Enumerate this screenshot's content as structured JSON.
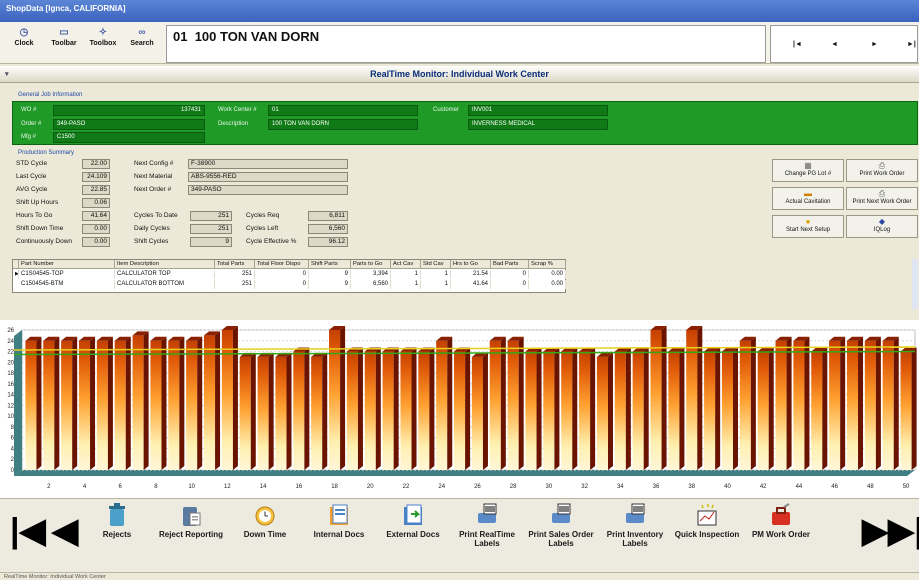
{
  "window": {
    "title": "ShopData [Ignca, CALIFORNIA]"
  },
  "toolbar": {
    "buttons": [
      {
        "label": "Clock",
        "icon": "clock-icon"
      },
      {
        "label": "Toolbar",
        "icon": "toolbar-icon"
      },
      {
        "label": "Toolbox",
        "icon": "toolbox-icon"
      },
      {
        "label": "Search",
        "icon": "binoculars-icon"
      }
    ]
  },
  "header": {
    "station": "01",
    "name": "100 TON VAN DORN"
  },
  "nav": {
    "first": "|◄",
    "prev": "◄",
    "next": "►",
    "last": "►|"
  },
  "monitor": {
    "title": "RealTime Monitor: Individual Work Center"
  },
  "general_job": {
    "section_label": "General Job Information",
    "wo_label": "WO #",
    "wo_value": "137431",
    "order_label": "Order #",
    "order_value": "349-PASO",
    "mfg_label": "Mfg #",
    "mfg_value": "C1500",
    "work_center_label": "Work Center #",
    "work_center_value": "01",
    "description_label": "Description",
    "description_value": "100 TON VAN DORN",
    "customer_label": "Customer",
    "customer_code": "INV001",
    "customer_name": "INVERNESS MEDICAL"
  },
  "production": {
    "section_label": "Production Summary",
    "std_cycle_label": "STD Cycle",
    "std_cycle": "22.00",
    "last_cycle_label": "Last Cycle",
    "last_cycle": "24.109",
    "avg_cycle_label": "AVG Cycle",
    "avg_cycle": "22.85",
    "shift_up_label": "Shift Up Hours",
    "shift_up": "0.06",
    "hours_to_go_label": "Hours To Go",
    "hours_to_go": "41.64",
    "shift_down_label": "Shift Down Time",
    "shift_down": "0.00",
    "cont_down_label": "Continuously Down",
    "cont_down": "0.00",
    "next_config_label": "Next Config #",
    "next_config": "F-38900",
    "next_material_label": "Next Material",
    "next_material": "ABS-9556-RED",
    "next_order_label": "Next Order #",
    "next_order": "349-PASO",
    "cycles_to_date_label": "Cycles To Date",
    "cycles_to_date": "251",
    "daily_cycles_label": "Daily Cycles",
    "daily_cycles": "251",
    "shift_cycles_label": "Shift Cycles",
    "shift_cycles": "9",
    "cycles_req_label": "Cycles Req",
    "cycles_req": "6,811",
    "cycles_left_label": "Cycles Left",
    "cycles_left": "6,560",
    "cycle_eff_label": "Cycle Effective %",
    "cycle_eff": "96.12"
  },
  "actions": [
    {
      "label": "Change PG Lot #",
      "icon": "calculator-icon"
    },
    {
      "label": "Print Work Order",
      "icon": "printer-icon"
    },
    {
      "label": "Actual Cavitation",
      "icon": "cavitation-icon"
    },
    {
      "label": "Print Next Work Order",
      "icon": "printer-icon"
    },
    {
      "label": "Start Next Setup",
      "icon": "setup-icon"
    },
    {
      "label": "IQLog",
      "icon": "log-icon"
    }
  ],
  "parts_table": {
    "headers": [
      "Part Number",
      "Item Description",
      "Total Parts",
      "Total Floor Dispo",
      "Shift Parts",
      "Parts to Go",
      "Act Cav",
      "Std Cav",
      "Hrs to Go",
      "Bad Parts",
      "Scrap %"
    ],
    "rows": [
      [
        "C1S04545-TOP",
        "CALCULATOR TOP",
        "251",
        "0",
        "9",
        "3,394",
        "1",
        "1",
        "21.54",
        "0",
        "0.00"
      ],
      [
        "C1504545-BTM",
        "CALCULATOR BOTTOM",
        "251",
        "0",
        "9",
        "6,560",
        "1",
        "1",
        "41.64",
        "0",
        "0.00"
      ]
    ]
  },
  "chart_data": {
    "type": "bar",
    "x": [
      1,
      2,
      3,
      4,
      5,
      6,
      7,
      8,
      9,
      10,
      11,
      12,
      13,
      14,
      15,
      16,
      17,
      18,
      19,
      20,
      21,
      22,
      23,
      24,
      25,
      26,
      27,
      28,
      29,
      30,
      31,
      32,
      33,
      34,
      35,
      36,
      37,
      38,
      39,
      40,
      41,
      42,
      43,
      44,
      45,
      46,
      47,
      48,
      49,
      50
    ],
    "x_tick_labels": [
      "2",
      "4",
      "6",
      "8",
      "10",
      "12",
      "14",
      "16",
      "18",
      "20",
      "22",
      "24",
      "26",
      "28",
      "30",
      "32",
      "34",
      "36",
      "38",
      "40",
      "42",
      "44",
      "46",
      "48",
      "50"
    ],
    "values": [
      24,
      24,
      24,
      24,
      24,
      24,
      25,
      24,
      24,
      24,
      25,
      26,
      21,
      21,
      21,
      22,
      21,
      26,
      22,
      22,
      22,
      22,
      22,
      24,
      22,
      21,
      24,
      24,
      22,
      22,
      22,
      22,
      21,
      22,
      22,
      26,
      22,
      26,
      22,
      22,
      24,
      22,
      24,
      24,
      22,
      24,
      24,
      24,
      24,
      22
    ],
    "y_tick_labels": [
      "0",
      "2",
      "4",
      "6",
      "8",
      "10",
      "12",
      "14",
      "16",
      "18",
      "20",
      "22",
      "24",
      "26"
    ],
    "ylim": [
      0,
      26
    ],
    "reference_lines": [
      22,
      22.85
    ],
    "grid": true,
    "colors": {
      "bar_light": "#fff2c0",
      "bar_mid": "#ff9a1e",
      "bar_dark": "#c04a00",
      "top": "#8a2000",
      "side": "#6a1400",
      "std_line": "#34a816",
      "avg_line": "#e8d020",
      "floor": "#3f7e82"
    }
  },
  "bottom": {
    "buttons": [
      {
        "label": "Rejects",
        "icon": "trash-can-icon"
      },
      {
        "label": "Reject Reporting",
        "icon": "reject-report-icon"
      },
      {
        "label": "Down Time",
        "icon": "alarm-clock-icon"
      },
      {
        "label": "Internal Docs",
        "icon": "internal-docs-icon"
      },
      {
        "label": "External Docs",
        "icon": "external-docs-icon"
      },
      {
        "label": "Print RealTime Labels",
        "icon": "barcode-printer-icon"
      },
      {
        "label": "Print Sales Order Labels",
        "icon": "barcode-printer-icon"
      },
      {
        "label": "Print Inventory Labels",
        "icon": "barcode-printer-icon"
      },
      {
        "label": "Quick Inspection",
        "icon": "inspection-icon"
      },
      {
        "label": "PM Work Order",
        "icon": "toolbox-red-icon"
      }
    ]
  },
  "status": {
    "text": "RealTime Monitor: Individual Work Center"
  }
}
